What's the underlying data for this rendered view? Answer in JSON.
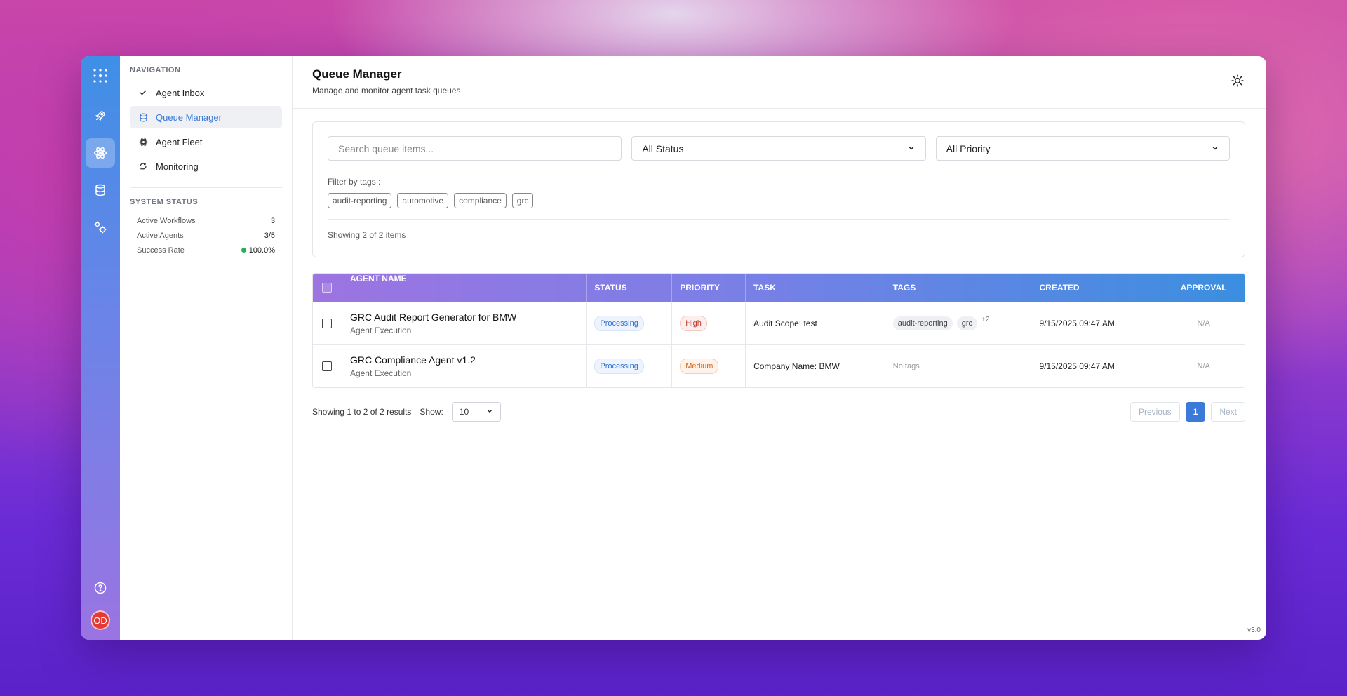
{
  "rail": {
    "avatar_initials": "OD"
  },
  "nav": {
    "heading": "NAVIGATION",
    "items": [
      {
        "label": "Agent Inbox",
        "icon": "check-icon"
      },
      {
        "label": "Queue Manager",
        "icon": "database-icon",
        "active": true
      },
      {
        "label": "Agent Fleet",
        "icon": "atom-icon"
      },
      {
        "label": "Monitoring",
        "icon": "refresh-icon"
      }
    ],
    "status_heading": "SYSTEM STATUS",
    "stats": [
      {
        "label": "Active Workflows",
        "value": "3"
      },
      {
        "label": "Active Agents",
        "value": "3/5"
      },
      {
        "label": "Success Rate",
        "value": "100.0%"
      }
    ]
  },
  "header": {
    "title": "Queue Manager",
    "subtitle": "Manage and monitor agent task queues"
  },
  "filters": {
    "search_placeholder": "Search queue items...",
    "status_value": "All Status",
    "priority_value": "All Priority",
    "tags_label": "Filter by tags :",
    "tags": [
      "audit-reporting",
      "automotive",
      "compliance",
      "grc"
    ],
    "showing": "Showing 2 of 2 items"
  },
  "table": {
    "columns": [
      "AGENT NAME",
      "STATUS",
      "PRIORITY",
      "TASK",
      "TAGS",
      "CREATED",
      "APPROVAL"
    ],
    "rows": [
      {
        "name": "GRC Audit Report Generator for BMW",
        "type": "Agent Execution",
        "status": "Processing",
        "priority": "High",
        "task": "Audit Scope: test",
        "tags": [
          "audit-reporting",
          "grc"
        ],
        "more_tags": "+2",
        "created": "9/15/2025 09:47 AM",
        "approval": "N/A"
      },
      {
        "name": "GRC Compliance Agent v1.2",
        "type": "Agent Execution",
        "status": "Processing",
        "priority": "Medium",
        "task": "Company Name: BMW",
        "no_tags": "No tags",
        "created": "9/15/2025 09:47 AM",
        "approval": "N/A"
      }
    ]
  },
  "pagination": {
    "summary": "Showing 1 to 2 of 2 results",
    "show_label": "Show:",
    "page_size": "10",
    "previous": "Previous",
    "current_page": "1",
    "next": "Next"
  },
  "footer": {
    "version": "v3.0"
  },
  "colors": {
    "accent": "#3b7ad9",
    "status_processing": "#2e6fd1",
    "priority_high": "#c0392b",
    "priority_medium": "#d2691e",
    "success": "#22b05a"
  }
}
